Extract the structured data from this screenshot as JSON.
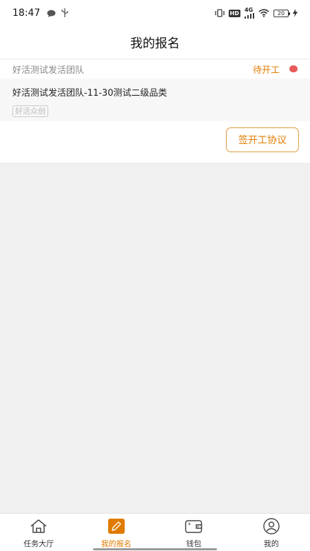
{
  "status_bar": {
    "time": "18:47",
    "hd": "HD",
    "network": "4G",
    "battery": "20"
  },
  "header": {
    "title": "我的报名"
  },
  "card": {
    "team_name": "好活测试发活团队",
    "status": "待开工",
    "task_title": "好活测试发活团队-11-30测试二级品类",
    "tag": "好活众创",
    "action_label": "签开工协议"
  },
  "tabbar": {
    "tabs": [
      {
        "label": "任务大厅",
        "icon": "house-icon"
      },
      {
        "label": "我的报名",
        "icon": "pencil-edit-icon"
      },
      {
        "label": "钱包",
        "icon": "wallet-icon"
      },
      {
        "label": "我的",
        "icon": "user-icon"
      }
    ],
    "active_index": 1
  },
  "colors": {
    "accent": "#e07b00",
    "status_dot": "#e85a5a",
    "page_bg": "#f0f0f0"
  }
}
